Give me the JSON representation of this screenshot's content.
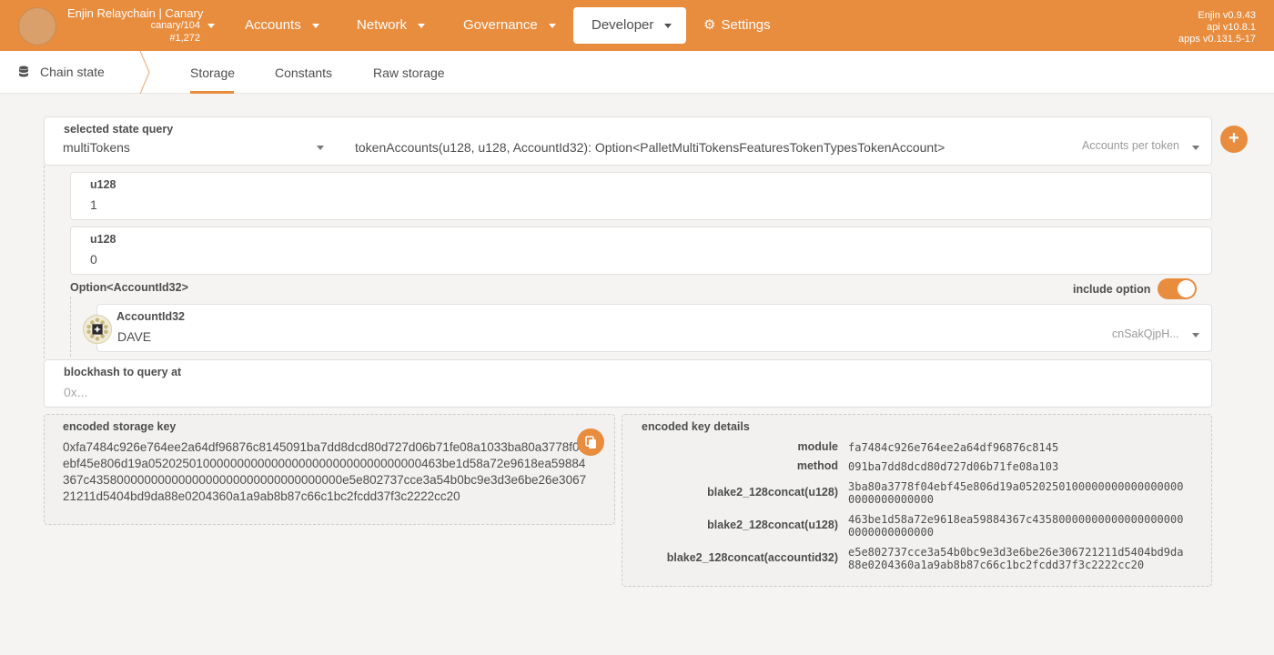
{
  "header": {
    "chain_name": "Enjin Relaychain | Canary",
    "spec": "canary/104",
    "block": "#1,272",
    "nav": [
      {
        "label": "Accounts"
      },
      {
        "label": "Network"
      },
      {
        "label": "Governance"
      },
      {
        "label": "Developer"
      },
      {
        "label": "Settings"
      }
    ],
    "versions": {
      "client": "Enjin v0.9.43",
      "api": "api v10.8.1",
      "apps": "apps v0.131.5-17"
    }
  },
  "subnav": {
    "section": "Chain state",
    "tabs": [
      {
        "label": "Storage"
      },
      {
        "label": "Constants"
      },
      {
        "label": "Raw storage"
      }
    ]
  },
  "query": {
    "label": "selected state query",
    "module": "multiTokens",
    "method_signature": "tokenAccounts(u128, u128, AccountId32): Option<PalletMultiTokensFeaturesTokenTypesTokenAccount>",
    "method_description": "Accounts per token"
  },
  "params": {
    "p1_label": "u128",
    "p1_value": "1",
    "p2_label": "u128",
    "p2_value": "0",
    "option_label": "Option<AccountId32>",
    "include_option_label": "include option",
    "account_label": "AccountId32",
    "account_name": "DAVE",
    "account_address_short": "cnSakQjpH..."
  },
  "blockhash": {
    "label": "blockhash to query at",
    "placeholder": "0x..."
  },
  "encoded": {
    "label": "encoded storage key",
    "value": "0xfa7484c926e764ee2a64df96876c8145091ba7dd8dcd80d727d06b71fe08a1033ba80a3778f04ebf45e806d19a0520250100000000000000000000000000000000463be1d58a72e9618ea59884367c4358000000000000000000000000000000000e5e802737cce3a54b0bc9e3d3e6be26e306721211d5404bd9da88e0204360a1a9ab8b87c66c1bc2fcdd37f3c2222cc20"
  },
  "key_details": {
    "label": "encoded key details",
    "rows": [
      {
        "name": "module",
        "value": "fa7484c926e764ee2a64df96876c8145"
      },
      {
        "name": "method",
        "value": "091ba7dd8dcd80d727d06b71fe08a103"
      },
      {
        "name": "blake2_128concat(u128)",
        "value": "3ba80a3778f04ebf45e806d19a05202501000000000000000000000000000000"
      },
      {
        "name": "blake2_128concat(u128)",
        "value": "463be1d58a72e9618ea59884367c435800000000000000000000000000000000"
      },
      {
        "name": "blake2_128concat(accountid32)",
        "value": "e5e802737cce3a54b0bc9e3d3e6be26e306721211d5404bd9da88e0204360a1a9ab8b87c66c1bc2fcdd37f3c2222cc20"
      }
    ]
  },
  "colors": {
    "accent": "#e88c3e",
    "background": "#f5f4f3"
  }
}
